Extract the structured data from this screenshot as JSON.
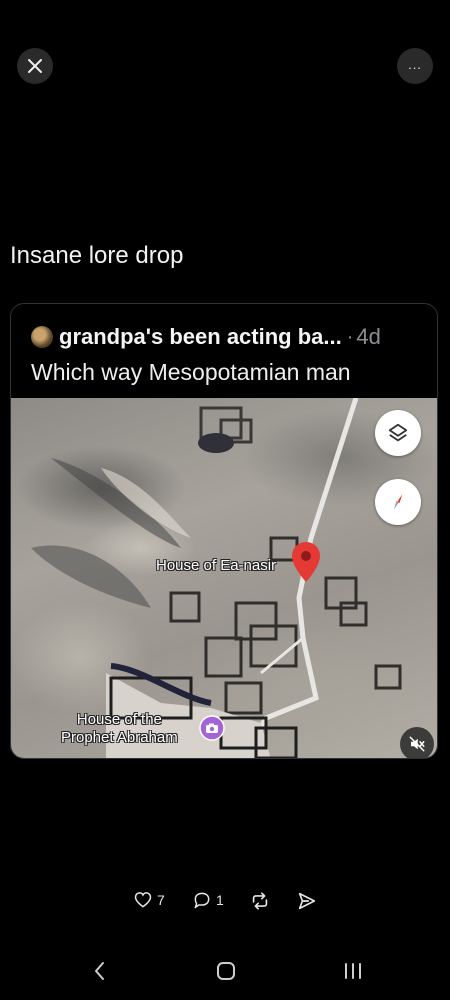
{
  "top_bar": {
    "close_icon": "close-icon",
    "more_icon": "more-horizontal-icon",
    "more_glyph": "..."
  },
  "post": {
    "text": "Insane lore drop"
  },
  "quoted_post": {
    "author_name": "grandpa's been acting ba...",
    "separator": "·",
    "age": "4d",
    "text": "Which way Mesopotamian man",
    "map": {
      "label_ea_nasir": "House of Ea-nasir",
      "label_abraham_line1": "House of the",
      "label_abraham_line2": "Prophet Abraham",
      "layers_icon": "layers-icon",
      "compass_icon": "compass-icon",
      "pin_color": "#e53935",
      "poi_color": "#a463d6"
    }
  },
  "actions": {
    "likes": "7",
    "replies": "1"
  },
  "navbar": {
    "back_icon": "back-chevron-icon",
    "home_icon": "home-icon",
    "recent_icon": "recent-apps-icon"
  }
}
